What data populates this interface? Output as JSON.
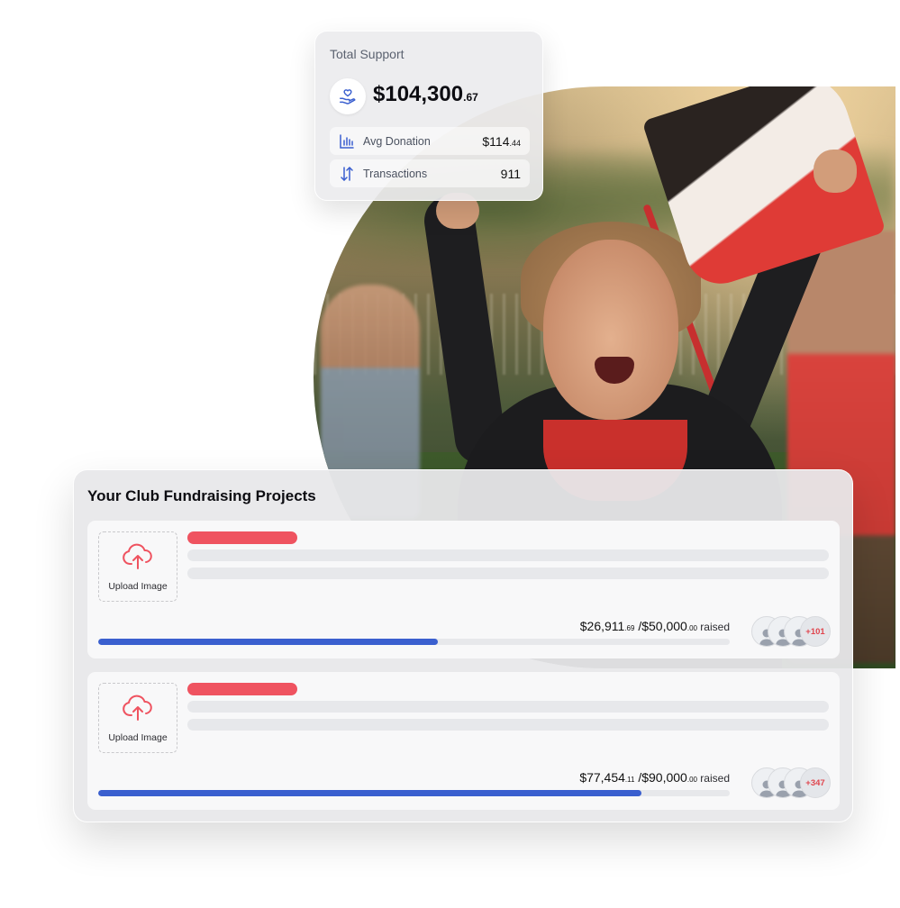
{
  "colors": {
    "accent_red": "#ef5360",
    "progress_blue": "#3a5fcf",
    "icon_blue": "#3a5fcf"
  },
  "support": {
    "title": "Total Support",
    "amount_main": "$104,300",
    "amount_cents": ".67",
    "icon": "heart-hand-icon",
    "stats": [
      {
        "icon": "bar-chart-icon",
        "label": "Avg Donation",
        "value_main": "$114",
        "value_cents": ".44"
      },
      {
        "icon": "transfer-arrows-icon",
        "label": "Transactions",
        "value_main": "911",
        "value_cents": ""
      }
    ]
  },
  "projects": {
    "title": "Your Club Fundraising Projects",
    "items": [
      {
        "upload_label": "Upload Image",
        "upload_icon": "cloud-upload-icon",
        "raised_main": "$26,911",
        "raised_cents": ".69",
        "goal_main": " /$50,000",
        "goal_cents": ".00",
        "raised_word": " raised",
        "progress": 0.5382,
        "supporters_more": "+101"
      },
      {
        "upload_label": "Upload Image",
        "upload_icon": "cloud-upload-icon",
        "raised_main": "$77,454",
        "raised_cents": ".11",
        "goal_main": " /$90,000",
        "goal_cents": ".00",
        "raised_word": " raised",
        "progress": 0.8606,
        "supporters_more": "+347"
      }
    ]
  }
}
